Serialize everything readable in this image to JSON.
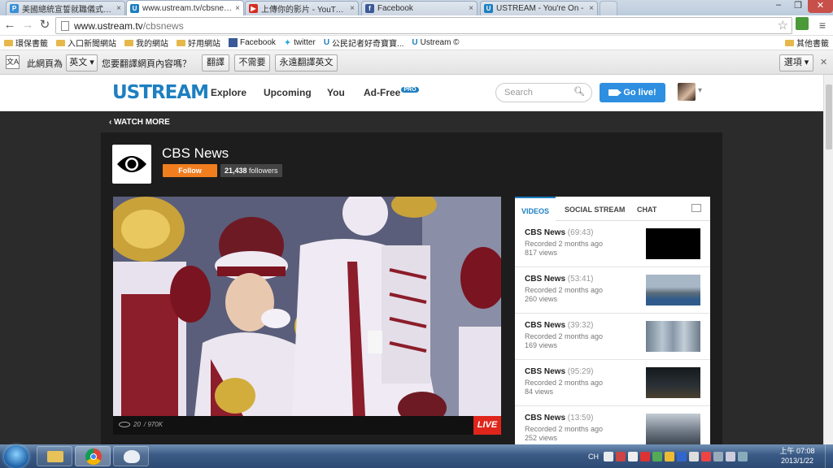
{
  "browser": {
    "tabs": [
      {
        "title": "美國總統宣誓就職儀式很…",
        "favicon": "p-icon",
        "color": "#3a8fd6",
        "active": false
      },
      {
        "title": "www.ustream.tv/cbsnews",
        "favicon": "ustream-icon",
        "color": "#1d7fc1",
        "active": true
      },
      {
        "title": "上傳你的影片 - YouTube",
        "favicon": "youtube-icon",
        "color": "#d62d20",
        "active": false
      },
      {
        "title": "Facebook",
        "favicon": "facebook-icon",
        "color": "#3b5998",
        "active": false
      },
      {
        "title": "USTREAM - You're On -",
        "favicon": "ustream-icon",
        "color": "#1d7fc1",
        "active": false
      }
    ],
    "url_host": "www.ustream.tv",
    "url_path": "/cbsnews",
    "bookmarks": [
      {
        "label": "環保書籤",
        "icon": "folder-icon"
      },
      {
        "label": "入口新聞網站",
        "icon": "folder-icon"
      },
      {
        "label": "我的網站",
        "icon": "folder-icon"
      },
      {
        "label": "好用網站",
        "icon": "folder-icon"
      },
      {
        "label": "Facebook",
        "icon": "facebook-icon"
      },
      {
        "label": "twitter",
        "icon": "twitter-icon"
      },
      {
        "label": "公民記者好奇寶寶...",
        "icon": "ustream-icon"
      },
      {
        "label": "Ustream ©",
        "icon": "ustream-icon"
      }
    ],
    "other_bookmarks": "其他書籤"
  },
  "translate_bar": {
    "prefix": "此網頁為",
    "language": "英文",
    "question": "您要翻譯網頁內容嗎？",
    "translate_btn": "翻譯",
    "no_btn": "不需要",
    "always_btn": "永遠翻譯英文",
    "options_btn": "選項"
  },
  "ustream": {
    "logo": "USTREAM",
    "nav": [
      "Explore",
      "Upcoming",
      "You"
    ],
    "adfree": "Ad-Free",
    "adfree_badge": "PRO",
    "search_placeholder": "Search",
    "golive": "Go live!",
    "watch_more": "WATCH MORE"
  },
  "channel": {
    "title": "CBS News",
    "follow": "Follow",
    "followers_count": "21,438",
    "followers_label": "followers"
  },
  "player": {
    "viewers": "20",
    "total": "/ 970K",
    "live": "LIVE"
  },
  "sidebar": {
    "tabs": [
      "VIDEOS",
      "SOCIAL STREAM",
      "CHAT"
    ],
    "videos": [
      {
        "title": "CBS News",
        "duration": "(69:43)",
        "recorded": "Recorded 2 months ago",
        "views": "817 views",
        "thumb": "#000000"
      },
      {
        "title": "CBS News",
        "duration": "(53:41)",
        "recorded": "Recorded 2 months ago",
        "views": "260 views",
        "thumb": "#7c8ea3"
      },
      {
        "title": "CBS News",
        "duration": "(39:32)",
        "recorded": "Recorded 2 months ago",
        "views": "169 views",
        "thumb": "#8fa3b5"
      },
      {
        "title": "CBS News",
        "duration": "(95:29)",
        "recorded": "Recorded 2 months ago",
        "views": "84 views",
        "thumb": "#1c2024"
      },
      {
        "title": "CBS News",
        "duration": "(13:59)",
        "recorded": "Recorded 2 months ago",
        "views": "252 views",
        "thumb": "#8c96a3"
      }
    ]
  },
  "taskbar": {
    "time": "上午 07:08",
    "date": "2013/1/22",
    "lang": "CH"
  }
}
